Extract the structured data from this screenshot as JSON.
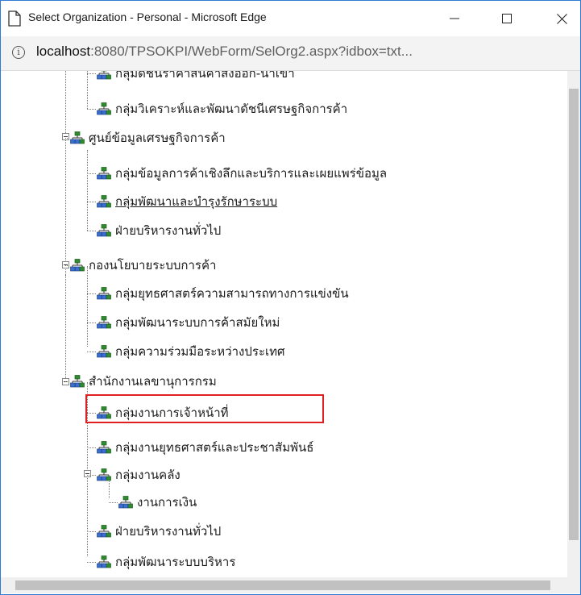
{
  "window": {
    "title": "Select Organization - Personal - Microsoft Edge",
    "minimize_label": "—",
    "maximize_label": "☐",
    "close_label": "✕"
  },
  "address": {
    "host": "localhost",
    "rest": ":8080/TPSOKPI/WebForm/SelOrg2.aspx?idbox=txt..."
  },
  "tree": {
    "items": [
      {
        "label": "กลุ่มดัชนีราคาสินค้าส่งออก-นำเข้า"
      },
      {
        "label": "กลุ่มวิเคราะห์และพัฒนาดัชนีเศรษฐกิจการค้า"
      },
      {
        "label": "ศูนย์ข้อมูลเศรษฐกิจการค้า"
      },
      {
        "label": "กลุ่มข้อมูลการค้าเชิงลึกและบริการและเผยแพร่ข้อมูล"
      },
      {
        "label": "กลุ่มพัฒนาและบำรุงรักษาระบบ"
      },
      {
        "label": "ฝ่ายบริหารงานทั่วไป"
      },
      {
        "label": "กองนโยบายระบบการค้า"
      },
      {
        "label": "กลุ่มยุทธศาสตร์ความสามารถทางการแข่งขัน"
      },
      {
        "label": "กลุ่มพัฒนาระบบการค้าสมัยใหม่"
      },
      {
        "label": "กลุ่มความร่วมมือระหว่างประเทศ"
      },
      {
        "label": "สำนักงานเลขานุการกรม"
      },
      {
        "label": "กลุ่มงานการเจ้าหน้าที่"
      },
      {
        "label": "กลุ่มงานยุทธศาสตร์และประชาสัมพันธ์"
      },
      {
        "label": "กลุ่มงานคลัง"
      },
      {
        "label": "งานการเงิน"
      },
      {
        "label": "ฝ่ายบริหารงานทั่วไป"
      },
      {
        "label": "กลุ่มพัฒนาระบบบริหาร"
      }
    ]
  },
  "colors": {
    "highlight": "#e02020",
    "icon_green": "#2e8b2e",
    "icon_blue": "#3a6fd0"
  }
}
